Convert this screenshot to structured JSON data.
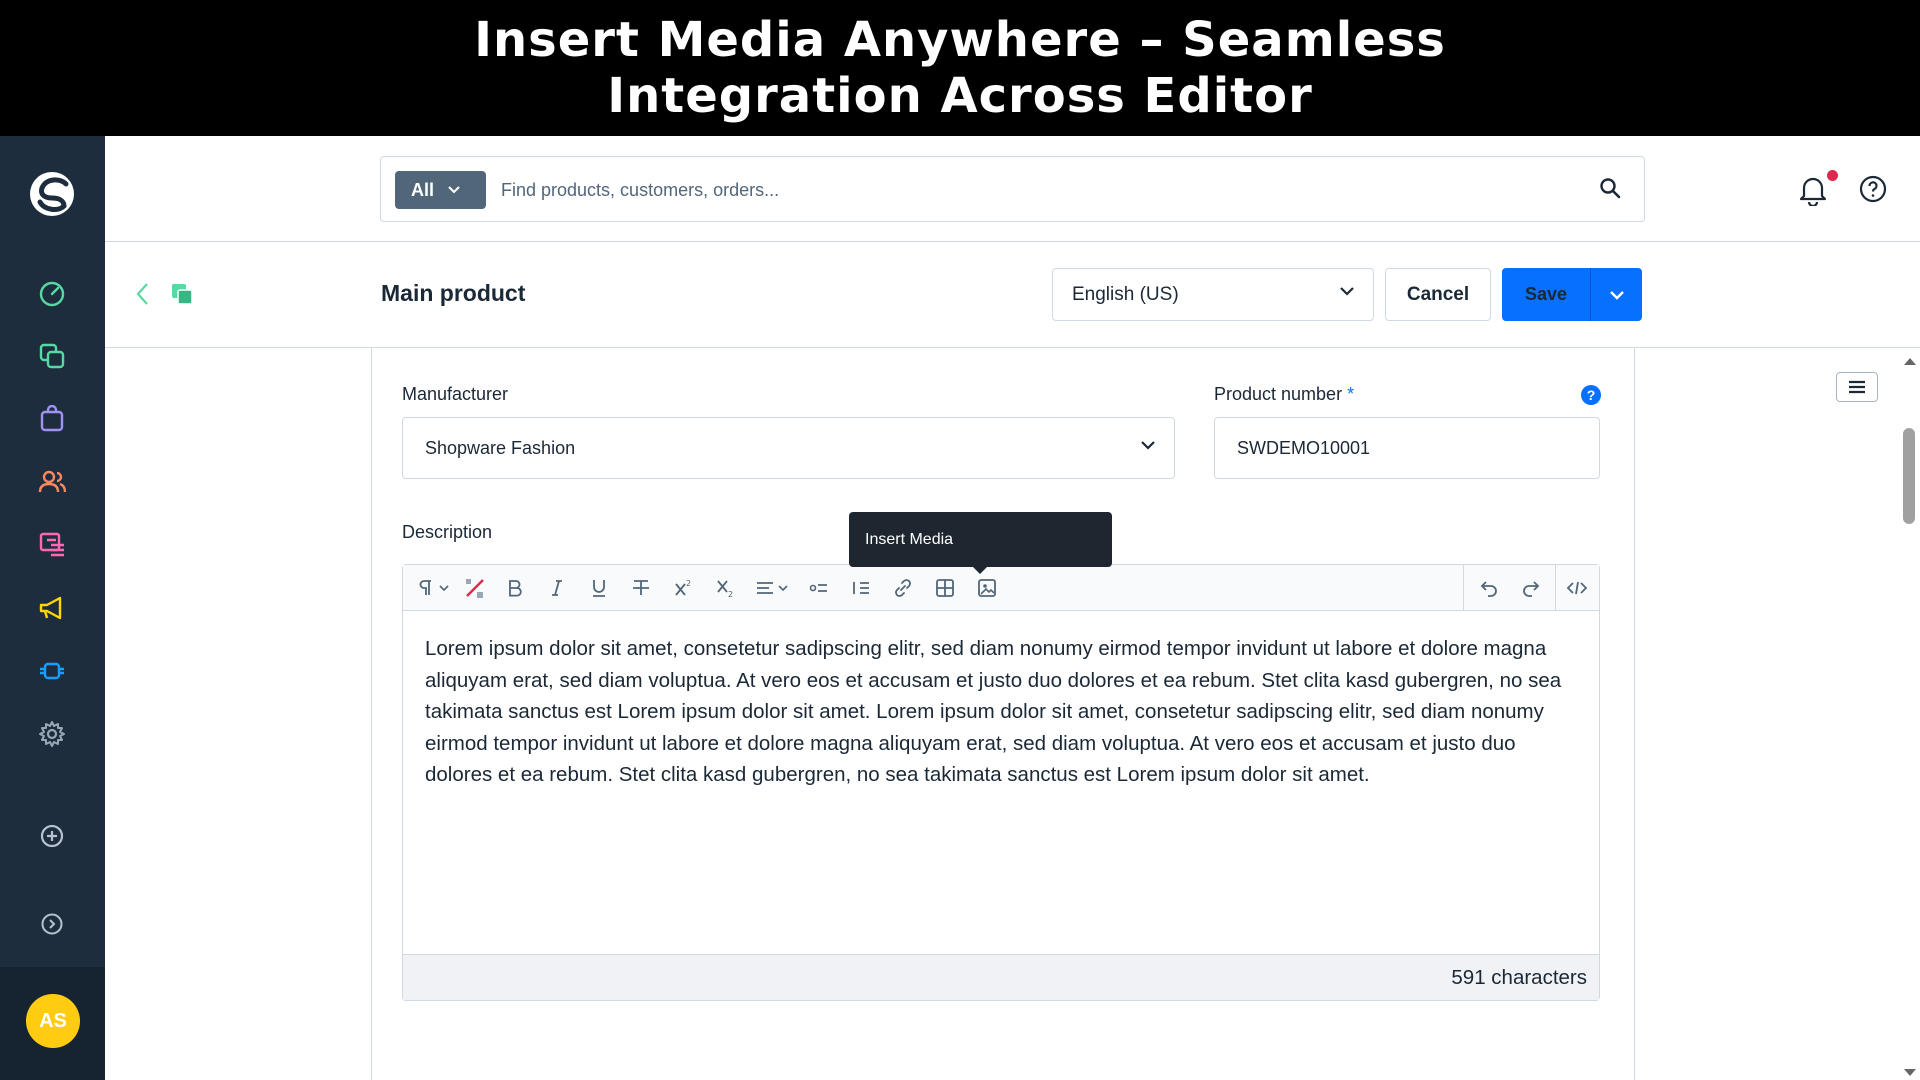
{
  "banner": {
    "title": "Insert Media Anywhere – Seamless Integration Across Editor"
  },
  "sidebar": {
    "items": [
      {
        "icon": "dashboard-icon",
        "color": "#57d9a3"
      },
      {
        "icon": "catalogues-icon",
        "color": "#57d9a3"
      },
      {
        "icon": "orders-icon",
        "color": "#a092f0"
      },
      {
        "icon": "customers-icon",
        "color": "#f88962"
      },
      {
        "icon": "content-icon",
        "color": "#ff68b4"
      },
      {
        "icon": "marketing-icon",
        "color": "#ffd700"
      },
      {
        "icon": "extensions-icon",
        "color": "#189eff"
      },
      {
        "icon": "settings-icon",
        "color": "#9aa8b5"
      }
    ],
    "avatar_initials": "AS",
    "avatar_color": "#ffcc12"
  },
  "search": {
    "scope_label": "All",
    "placeholder": "Find products, customers, orders..."
  },
  "smartbar": {
    "title": "Main product",
    "language": "English (US)",
    "cancel_label": "Cancel",
    "save_label": "Save"
  },
  "form": {
    "manufacturer_label": "Manufacturer",
    "manufacturer_value": "Shopware Fashion",
    "product_number_label": "Product number",
    "required_marker": "*",
    "product_number_value": "SWDEMO10001",
    "help_badge": "?",
    "description_label": "Description"
  },
  "editor": {
    "tooltip": "Insert Media",
    "body": "Lorem ipsum dolor sit amet, consetetur sadipscing elitr, sed diam nonumy eirmod tempor invidunt ut labore et dolore magna aliquyam erat, sed diam voluptua. At vero eos et accusam et justo duo dolores et ea rebum. Stet clita kasd gubergren, no sea takimata sanctus est Lorem ipsum dolor sit amet. Lorem ipsum dolor sit amet, consetetur sadipscing elitr, sed diam nonumy eirmod tempor invidunt ut labore et dolore magna aliquyam erat, sed diam voluptua. At vero eos et accusam et justo duo dolores et ea rebum. Stet clita kasd gubergren, no sea takimata sanctus est Lorem ipsum dolor sit amet.",
    "char_count": "591 characters"
  },
  "colors": {
    "primary": "#0870ff",
    "sidebar": "#1e2d3d",
    "notification": "#de294c"
  }
}
